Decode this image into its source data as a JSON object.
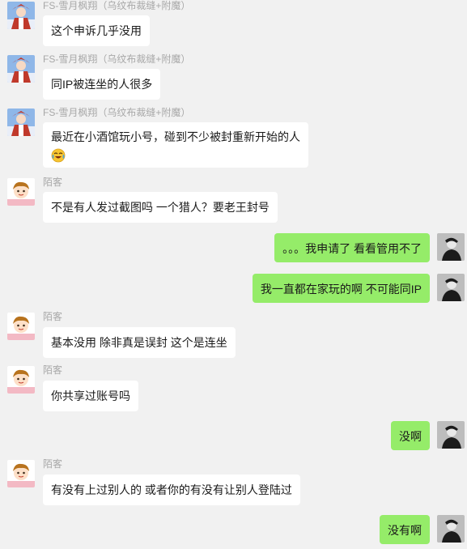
{
  "users": {
    "fs": {
      "name": "FS-雪月枫翔（乌纹布裁缝+附魔）",
      "avatar_icon": "anime-character-avatar-icon"
    },
    "guest": {
      "name": "陌客",
      "avatar_icon": "cartoon-child-avatar-icon"
    },
    "me": {
      "avatar_icon": "photo-person-avatar-icon"
    }
  },
  "messages": [
    {
      "sender": "FS-雪月枫翔（乌纹布裁缝+附魔）",
      "text": "这个申诉几乎没用"
    },
    {
      "sender": "FS-雪月枫翔（乌纹布裁缝+附魔）",
      "text": "同IP被连坐的人很多"
    },
    {
      "sender": "FS-雪月枫翔（乌纹布裁缝+附魔）",
      "text": "最近在小酒馆玩小号，碰到不少被封重新开始的人",
      "emoji": "crying-laughing-emoji"
    },
    {
      "sender": "陌客",
      "text": "不是有人发过截图吗   一个猎人？要老王封号"
    },
    {
      "text": "。。。我申请了  看看管用不了"
    },
    {
      "text": "我一直都在家玩的啊 不可能同IP"
    },
    {
      "sender": "陌客",
      "text": "基本没用  除非真是误封   这个是连坐"
    },
    {
      "sender": "陌客",
      "text": "你共享过账号吗"
    },
    {
      "text": "没啊"
    },
    {
      "sender": "陌客",
      "text": "有没有上过别人的  或者你的有没有让别人登陆过"
    },
    {
      "text": "没有啊"
    }
  ]
}
